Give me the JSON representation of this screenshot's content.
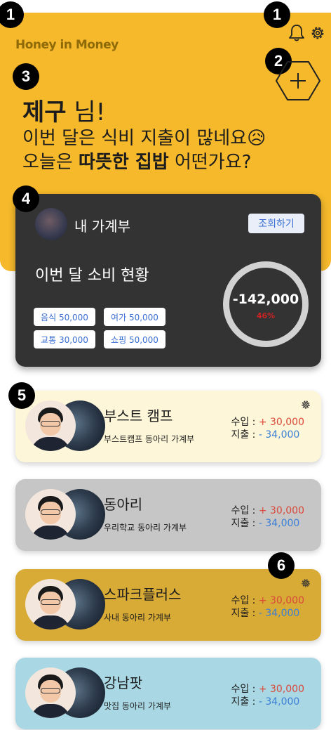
{
  "header": {
    "brand": "Honey in Money",
    "bg_color": "#f5b92b"
  },
  "badges": [
    "1",
    "1",
    "2",
    "3",
    "4",
    "5",
    "6"
  ],
  "greeting": {
    "name": "제구",
    "suffix": " 님!",
    "line2": "이번 달은 식비 지출이 많네요😥",
    "line3_prefix": "오늘은 ",
    "line3_bold": "따뜻한 집밥",
    "line3_suffix": " 어떤가요?"
  },
  "card": {
    "title": "내 가계부",
    "lookup_label": "조회하기",
    "spend_title": "이번 달 소비 현황",
    "chips": [
      "음식 50,000",
      "여가 50,000",
      "교통 30,000",
      "쇼핑 50,000"
    ],
    "ring_amount": "-142,000",
    "ring_percent": "46%"
  },
  "groups": [
    {
      "name": "부스트 캠프",
      "desc": "부스트캠프 동아리 가계부",
      "income_label": "수입 :",
      "income": "+ 30,000",
      "expense_label": "지출 :",
      "expense": "- 34,000",
      "bg": "#fdf6d8"
    },
    {
      "name": "동아리",
      "desc": "우리학교 동아리 가계부",
      "income_label": "수입 :",
      "income": "+ 30,000",
      "expense_label": "지출 :",
      "expense": "- 34,000",
      "bg": "#c6c6c6"
    },
    {
      "name": "스파크플러스",
      "desc": "사내 동아리 가계부",
      "income_label": "수입 :",
      "income": "+ 30,000",
      "expense_label": "지출 :",
      "expense": "- 34,000",
      "bg": "#d8aa36"
    },
    {
      "name": "강남팟",
      "desc": "맛집 동아리 가계부",
      "income_label": "수입 :",
      "income": "+ 30,000",
      "expense_label": "지출 :",
      "expense": "- 34,000",
      "bg": "#a9d8e4"
    }
  ]
}
